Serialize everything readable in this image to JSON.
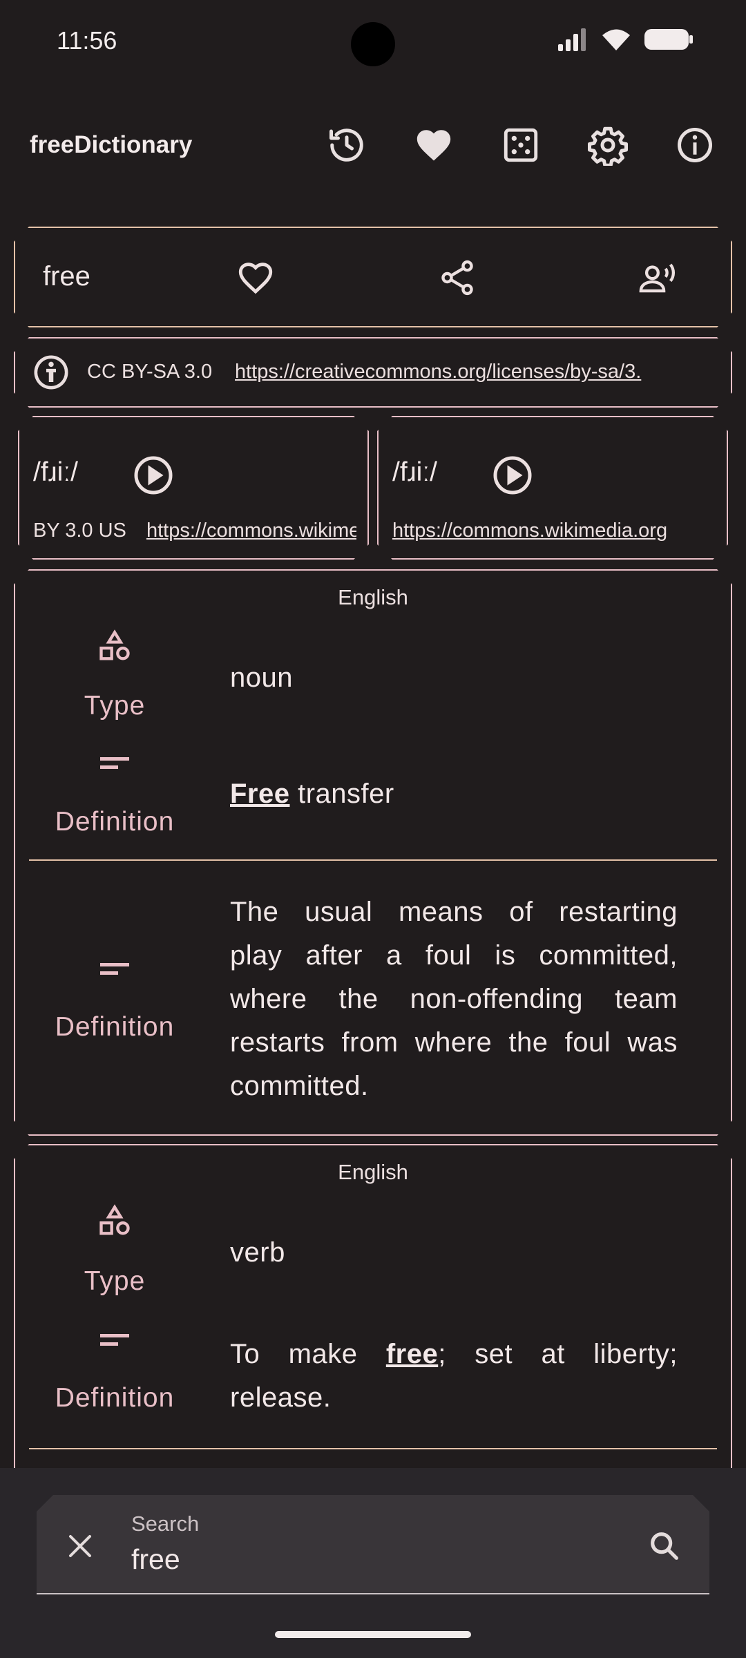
{
  "status_bar": {
    "time": "11:56"
  },
  "app_bar": {
    "title": "freeDictionary",
    "icons": [
      "history-icon",
      "favorite-icon",
      "random-dice-icon",
      "settings-icon",
      "info-icon"
    ]
  },
  "word_card": {
    "word": "free"
  },
  "license": {
    "name": "CC BY-SA 3.0",
    "url": "https://creativecommons.org/licenses/by-sa/3."
  },
  "phonetics": [
    {
      "text": "/fɹiː/",
      "license": "BY 3.0 US",
      "url": "https://commons.wikimedia.org"
    },
    {
      "text": "/fɹiː/",
      "url": "https://commons.wikimedia.org"
    }
  ],
  "meanings": [
    {
      "language": "English",
      "type_label": "Type",
      "type_value": "noun",
      "definitions": [
        {
          "label": "Definition",
          "link": "Free",
          "text": " transfer"
        },
        {
          "label": "Definition",
          "text": "The usual means of restarting play after a foul is committed, where the non-offending team restarts from where the foul was committed."
        }
      ]
    },
    {
      "language": "English",
      "type_label": "Type",
      "type_value": "verb",
      "definitions": [
        {
          "label": "Definition",
          "prefix": "To make ",
          "link": "free",
          "suffix": "; set at liberty; release."
        }
      ]
    }
  ],
  "search": {
    "label": "Search",
    "value": "free"
  },
  "colors": {
    "accent_border": "#e4c1a8",
    "accent_label": "#e9bfc7",
    "background": "#201c1d"
  }
}
